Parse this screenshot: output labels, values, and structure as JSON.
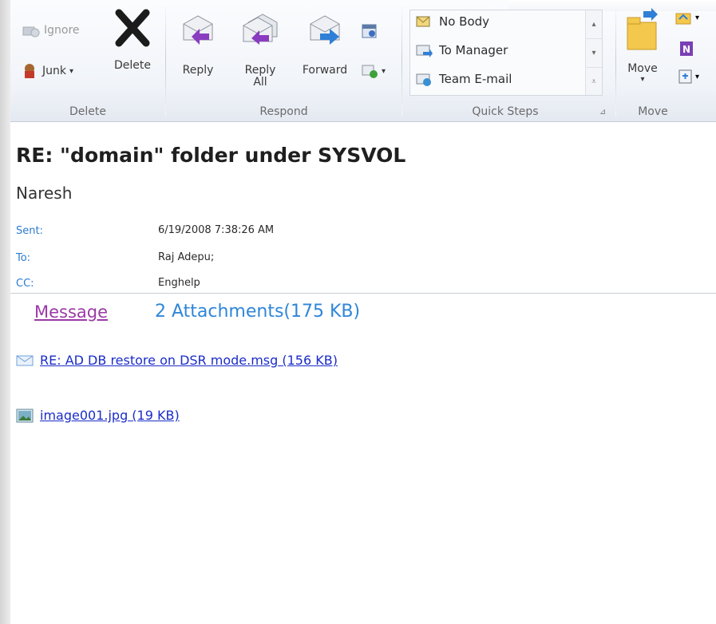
{
  "ribbon": {
    "delete_group": {
      "label": "Delete",
      "ignore": "Ignore",
      "junk": "Junk",
      "delete": "Delete"
    },
    "respond_group": {
      "label": "Respond",
      "reply": "Reply",
      "reply_all_line1": "Reply",
      "reply_all_line2": "All",
      "forward": "Forward"
    },
    "quick_steps_group": {
      "label": "Quick Steps",
      "items": [
        "No Body",
        "To Manager",
        "Team E-mail"
      ]
    },
    "move_group": {
      "label": "Move",
      "move": "Move"
    }
  },
  "message": {
    "subject": "RE: \"domain\" folder under SYSVOL",
    "sender": "Naresh",
    "sent_label": "Sent:",
    "sent_value": "6/19/2008 7:38:26 AM",
    "to_label": "To:",
    "to_value": "Raj Adepu;",
    "cc_label": "CC:",
    "cc_value": "Enghelp"
  },
  "tabs": {
    "message": "Message",
    "attachments": "2 Attachments(175 KB)"
  },
  "attachments": [
    {
      "name": "RE: AD DB restore on DSR mode.msg (156 KB)",
      "icon": "mail-icon"
    },
    {
      "name": "image001.jpg (19 KB)",
      "icon": "image-icon"
    }
  ],
  "colors": {
    "label_blue": "#2c7bd0",
    "link_blue": "#1a2cc8",
    "visited_purple": "#9a3aa6"
  }
}
